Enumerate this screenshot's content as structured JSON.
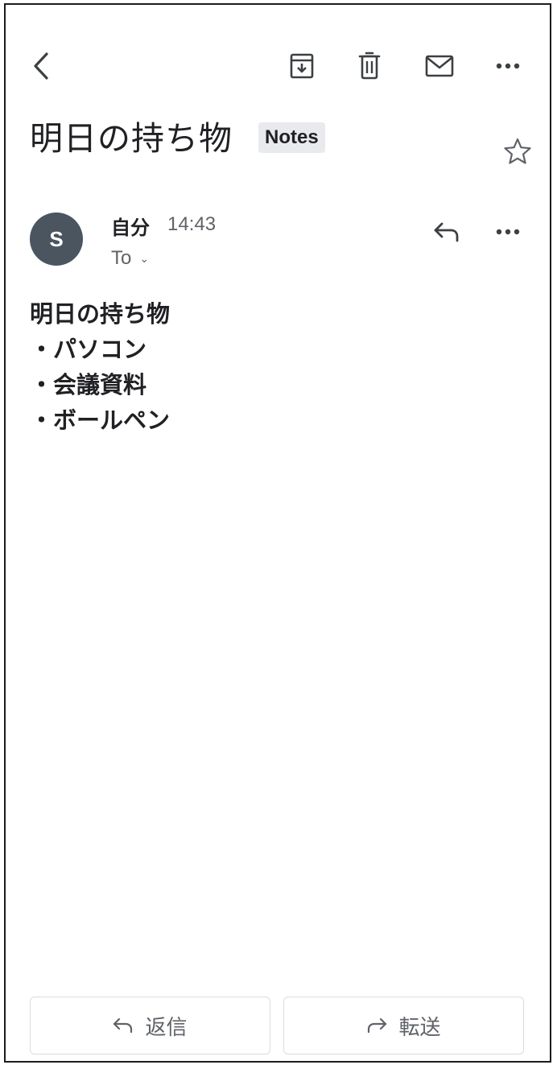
{
  "toolbar": {
    "back_icon": "chevron-left-icon",
    "archive_icon": "archive-icon",
    "delete_icon": "trash-icon",
    "mark_unread_icon": "envelope-icon",
    "more_icon": "more-horizontal-icon"
  },
  "message": {
    "subject": "明日の持ち物",
    "label": "Notes",
    "starred": false,
    "sender_initial": "S",
    "sender_name": "自分",
    "time": "14:43",
    "to_label": "To",
    "body_lines": [
      "明日の持ち物",
      "・パソコン",
      "・会議資料",
      "・ボールペン"
    ]
  },
  "actions": {
    "reply_label": "返信",
    "forward_label": "転送"
  },
  "colors": {
    "avatar_bg": "#4a5560",
    "chip_bg": "#e8eaed",
    "icon": "#5f6368"
  }
}
